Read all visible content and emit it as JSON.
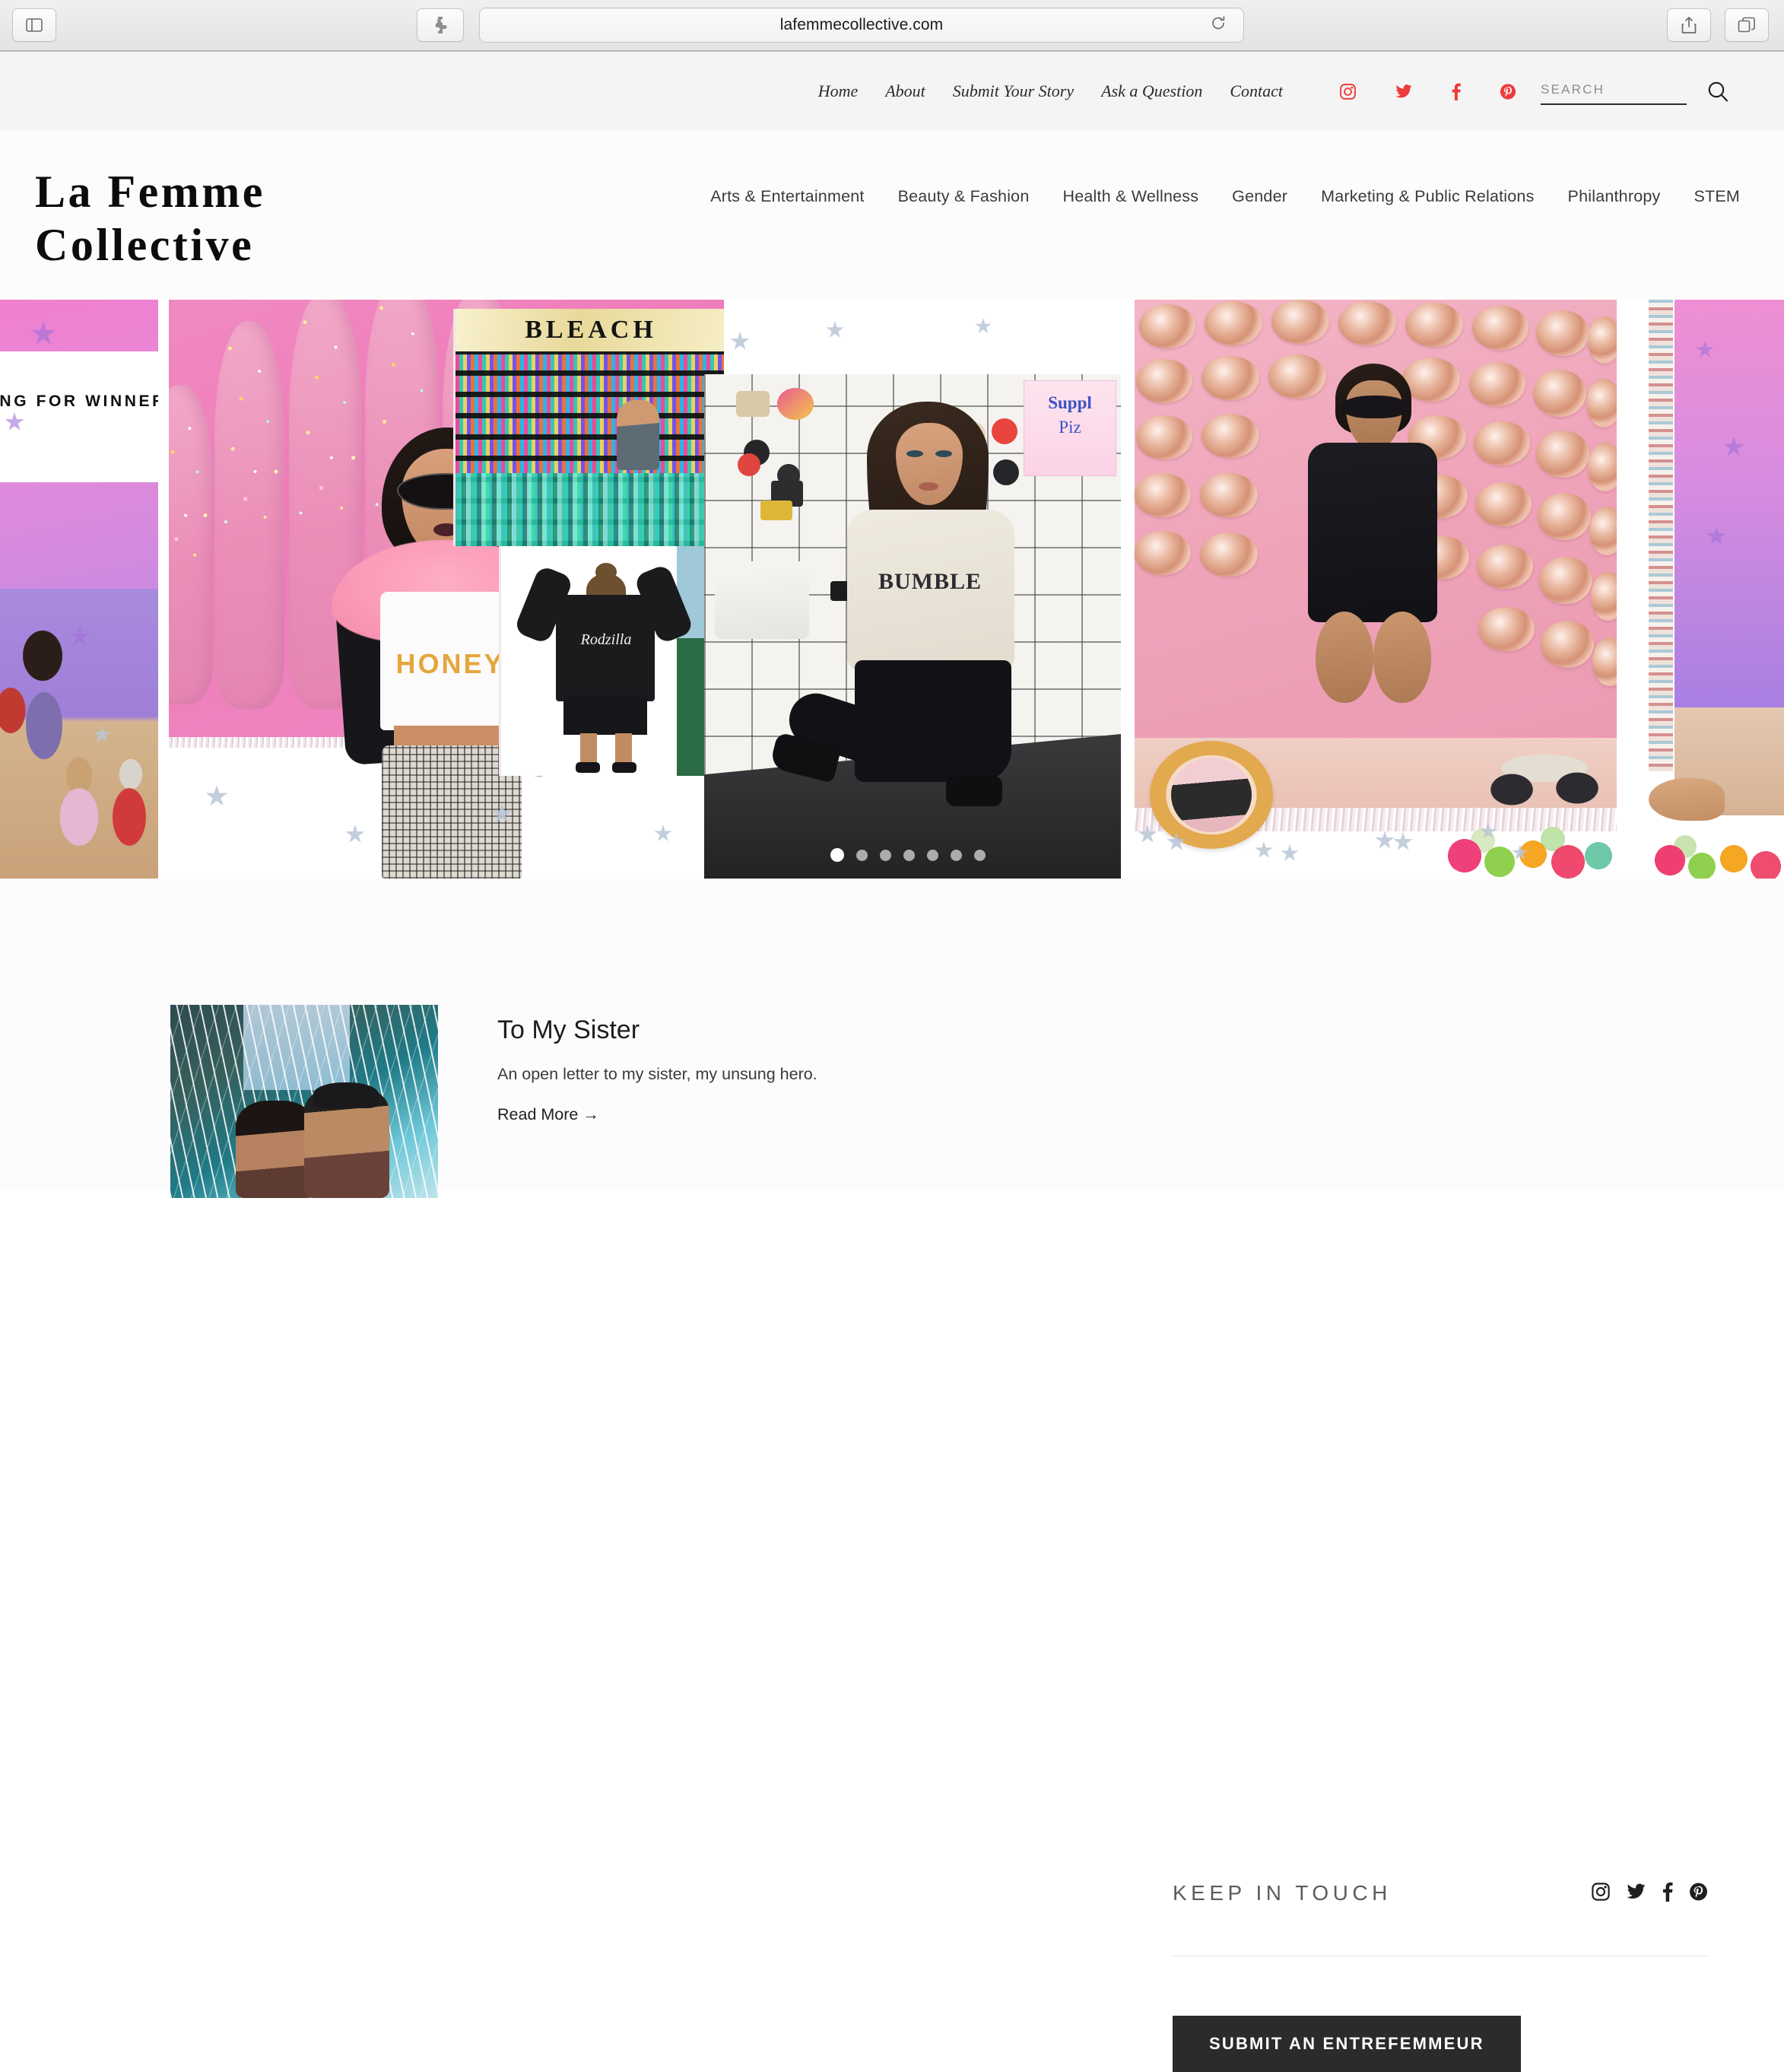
{
  "browser": {
    "url": "lafemmecollective.com",
    "sidebar_icon": "sidebar-toggle-icon",
    "extension_icon": "puzzle-extension-icon",
    "reload_icon": "reload-icon",
    "share_icon": "share-icon",
    "tabs_icon": "tab-overview-icon"
  },
  "topbar": {
    "nav": [
      {
        "label": "Home"
      },
      {
        "label": "About"
      },
      {
        "label": "Submit Your Story"
      },
      {
        "label": "Ask a Question"
      },
      {
        "label": "Contact"
      }
    ],
    "social": [
      {
        "name": "instagram-icon",
        "color": "#ef3b3b"
      },
      {
        "name": "twitter-icon",
        "color": "#ef3b3b"
      },
      {
        "name": "facebook-icon",
        "color": "#ef3b3b"
      },
      {
        "name": "pinterest-icon",
        "color": "#ef3b3b"
      }
    ],
    "search": {
      "placeholder": "SEARCH",
      "value": "",
      "submit_icon": "search-icon"
    }
  },
  "masthead": {
    "logo_line1": "La Femme",
    "logo_line2": "Collective",
    "categories": [
      {
        "label": "Arts & Entertainment"
      },
      {
        "label": "Beauty & Fashion"
      },
      {
        "label": "Health & Wellness"
      },
      {
        "label": "Gender"
      },
      {
        "label": "Marketing & Public Relations"
      },
      {
        "label": "Philanthropy"
      },
      {
        "label": "STEM"
      }
    ]
  },
  "hero": {
    "left_caption": "ING FOR WINNERS",
    "bleach_sign": "BLEACH",
    "honey_shirt": "HONEY",
    "rodzilla_jacket": "Rodzilla",
    "bumble_sweater": "BUMBLE",
    "poster_line1": "Suppl",
    "poster_line2": "Piz",
    "slide_count": 7,
    "active_slide": 1
  },
  "article": {
    "title": "To My Sister",
    "description": "An open letter to my sister, my unsung hero.",
    "read_more": "Read More →",
    "thumbnail_alt": "tropical-palm-collage-thumbnail"
  },
  "keep_in_touch": {
    "title": "KEEP IN TOUCH",
    "social": [
      {
        "name": "instagram-icon",
        "color": "#1f1f1f"
      },
      {
        "name": "twitter-icon",
        "color": "#1f1f1f"
      },
      {
        "name": "facebook-icon",
        "color": "#1f1f1f"
      },
      {
        "name": "pinterest-icon",
        "color": "#1f1f1f"
      }
    ],
    "submit_label": "SUBMIT AN ENTREFEMMEUR"
  },
  "colors": {
    "accent_red": "#ef3b3b",
    "button_dark": "#2b2b2b",
    "topbar_bg": "#f4f4f4",
    "page_bg": "#fcfcfc"
  }
}
